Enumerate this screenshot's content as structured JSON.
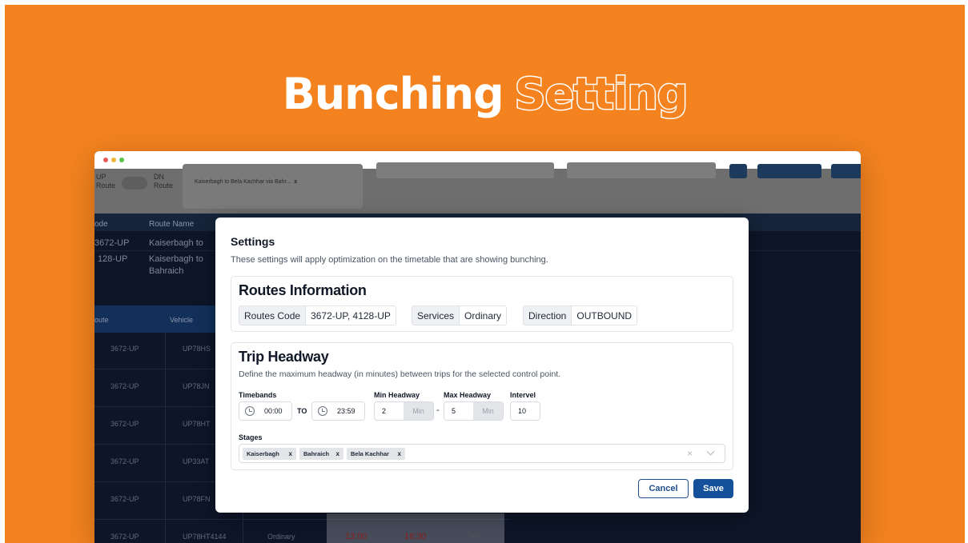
{
  "banner": {
    "word1": "Bunching",
    "word2": "Setting"
  },
  "window": {
    "dot_colors": [
      "#ed5a55",
      "#f2b43a",
      "#5bc04c"
    ]
  },
  "background_app": {
    "toggle": {
      "left_label": "UP Route",
      "right_label": "DN Route"
    },
    "route_chips": [
      "Kaiserbagh to Bela Kachhar via Bahr..."
    ],
    "route_chip_remove": "x",
    "table_headers": [
      "ode",
      "Route Name"
    ],
    "rows": [
      {
        "code": "3672-UP",
        "name": "Kaiserbagh to"
      },
      {
        "code": "128-UP",
        "name": "Kaiserbagh to",
        "name2": "Bahraich"
      }
    ],
    "grid_headers": [
      "oute",
      "Vehicle"
    ],
    "grid_rows": [
      {
        "route": "3672-UP",
        "vehicle": "UP78HS"
      },
      {
        "route": "3672-UP",
        "vehicle": "UP78JN"
      },
      {
        "route": "3672-UP",
        "vehicle": "UP78HT"
      },
      {
        "route": "3672-UP",
        "vehicle": "UP33AT"
      },
      {
        "route": "3672-UP",
        "vehicle": "UP78FN"
      },
      {
        "route": "3672-UP",
        "vehicle": "UP78HT4144",
        "service": "Ordinary",
        "t1": "13:00",
        "t2": "16:30",
        "t3": "-"
      }
    ]
  },
  "modal": {
    "title": "Settings",
    "subtitle": "These settings will apply optimization on the timetable that are showing bunching.",
    "routes_info": {
      "title": "Routes Information",
      "fields": [
        {
          "key": "Routes Code",
          "value": "3672-UP, 4128-UP"
        },
        {
          "key": "Services",
          "value": "Ordinary"
        },
        {
          "key": "Direction",
          "value": "OUTBOUND"
        }
      ]
    },
    "trip_headway": {
      "title": "Trip Headway",
      "subtitle": "Define the maximum headway (in minutes) between trips for the selected control point.",
      "timebands_label": "Timebands",
      "start_time": "00:00",
      "to_label": "TO",
      "end_time": "23:59",
      "min_headway_label": "Min Headway",
      "min_headway": "2",
      "max_headway_label": "Max Headway",
      "max_headway": "5",
      "unit": "Min",
      "dash": "-",
      "interval_label": "Intervel",
      "interval": "10",
      "stages_label": "Stages",
      "stages": [
        "Kaiserbagh",
        "Bahraich",
        "Bela Kachhar"
      ],
      "tag_remove": "x",
      "clear": "×"
    },
    "cancel_label": "Cancel",
    "save_label": "Save"
  }
}
